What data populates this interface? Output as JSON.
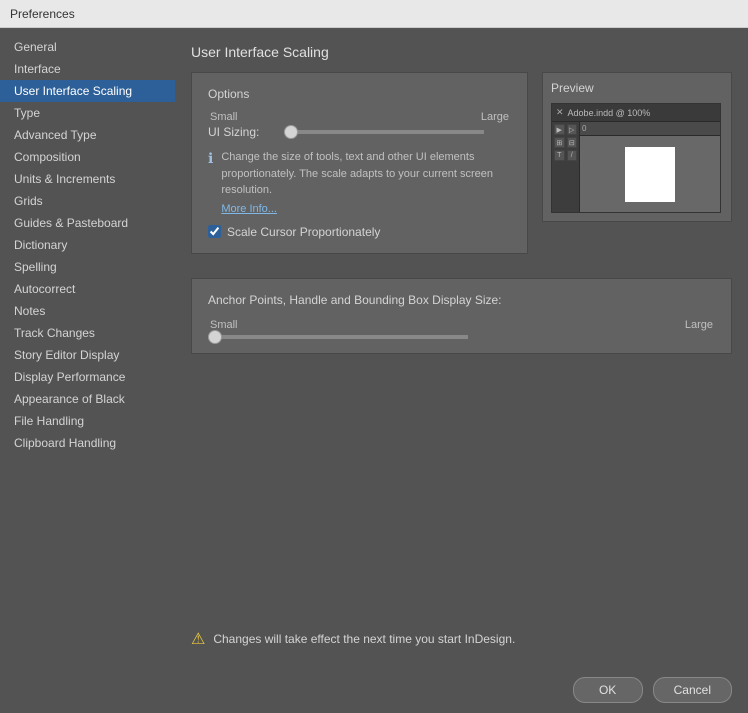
{
  "window": {
    "title": "Preferences"
  },
  "sidebar": {
    "items": [
      {
        "label": "General",
        "active": false
      },
      {
        "label": "Interface",
        "active": false
      },
      {
        "label": "User Interface Scaling",
        "active": true
      },
      {
        "label": "Type",
        "active": false
      },
      {
        "label": "Advanced Type",
        "active": false
      },
      {
        "label": "Composition",
        "active": false
      },
      {
        "label": "Units & Increments",
        "active": false
      },
      {
        "label": "Grids",
        "active": false
      },
      {
        "label": "Guides & Pasteboard",
        "active": false
      },
      {
        "label": "Dictionary",
        "active": false
      },
      {
        "label": "Spelling",
        "active": false
      },
      {
        "label": "Autocorrect",
        "active": false
      },
      {
        "label": "Notes",
        "active": false
      },
      {
        "label": "Track Changes",
        "active": false
      },
      {
        "label": "Story Editor Display",
        "active": false
      },
      {
        "label": "Display Performance",
        "active": false
      },
      {
        "label": "Appearance of Black",
        "active": false
      },
      {
        "label": "File Handling",
        "active": false
      },
      {
        "label": "Clipboard Handling",
        "active": false
      }
    ]
  },
  "main": {
    "title": "User Interface Scaling",
    "options_section": {
      "label": "Options",
      "slider_small": "Small",
      "slider_large": "Large",
      "ui_sizing_label": "UI Sizing:",
      "slider_value": 0,
      "info_text": "Change the size of tools, text and other UI elements proportionately. The scale adapts to your current screen resolution.",
      "more_info_link": "More Info...",
      "checkbox_label": "Scale Cursor Proportionately",
      "checkbox_checked": true
    },
    "preview": {
      "title": "Preview",
      "window_title": "Adobe.indd @ 100%",
      "ruler_value": "0"
    },
    "anchor_section": {
      "title": "Anchor Points, Handle and Bounding Box Display Size:",
      "slider_small": "Small",
      "slider_large": "Large",
      "slider_value": 0
    },
    "warning": {
      "text": "Changes will take effect the next time you start InDesign."
    }
  },
  "buttons": {
    "ok": "OK",
    "cancel": "Cancel"
  }
}
